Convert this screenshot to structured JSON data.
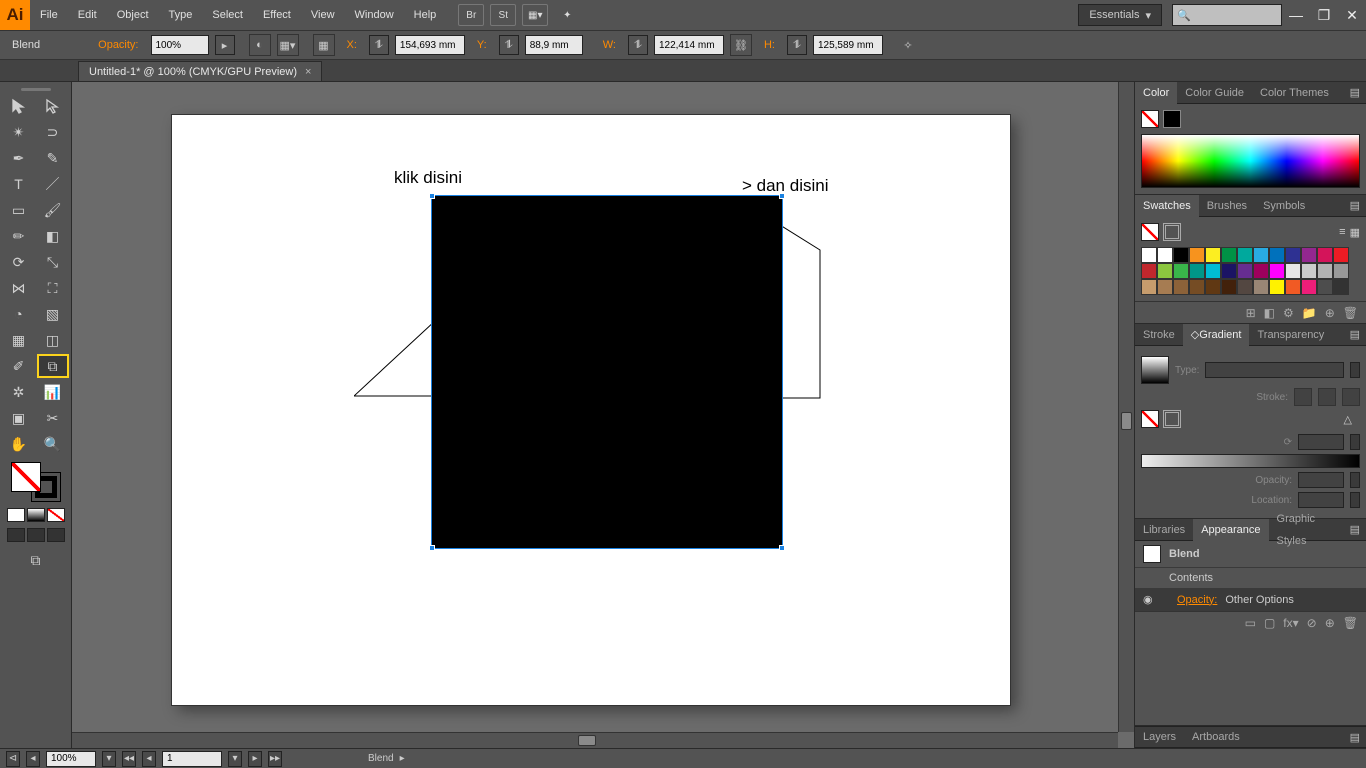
{
  "menu": [
    "File",
    "Edit",
    "Object",
    "Type",
    "Select",
    "Effect",
    "View",
    "Window",
    "Help"
  ],
  "workspace": "Essentials",
  "control": {
    "tool": "Blend",
    "opacity_label": "Opacity:",
    "opacity": "100%",
    "x_label": "X:",
    "x": "154,693 mm",
    "y_label": "Y:",
    "y": "88,9 mm",
    "w_label": "W:",
    "w": "122,414 mm",
    "h_label": "H:",
    "h": "125,589 mm"
  },
  "doc_tab": "Untitled-1* @ 100% (CMYK/GPU Preview)",
  "canvas": {
    "anno1": "klik disini",
    "anno2": "> dan disini"
  },
  "panels": {
    "color_tabs": [
      "Color",
      "Color Guide",
      "Color Themes"
    ],
    "swatch_tabs": [
      "Swatches",
      "Brushes",
      "Symbols"
    ],
    "grad_tabs": [
      "Stroke",
      "Gradient",
      "Transparency"
    ],
    "grad_type": "Type:",
    "grad_stroke": "Stroke:",
    "grad_opacity": "Opacity:",
    "grad_location": "Location:",
    "app_tabs": [
      "Libraries",
      "Appearance",
      "Graphic Styles"
    ],
    "app_rows": {
      "r1": "Blend",
      "r2": "Contents",
      "r3a": "Opacity:",
      "r3b": "Other Options"
    },
    "bottom_tabs": [
      "Layers",
      "Artboards"
    ]
  },
  "swatches_colors": [
    "#ffffff",
    "#ffffff",
    "#000000",
    "#f7931e",
    "#fcee21",
    "#009245",
    "#00a99d",
    "#29abe2",
    "#0071bc",
    "#2e3192",
    "#93278f",
    "#d4145a",
    "#ed1c24",
    "#c1272d",
    "#8cc63f",
    "#39b54a",
    "#009688",
    "#00bcd4",
    "#1b1464",
    "#662d91",
    "#9e005d",
    "#ff00ff",
    "#e6e6e6",
    "#cccccc",
    "#b3b3b3",
    "#999999",
    "#c69c6d",
    "#a67c52",
    "#8c6239",
    "#754c24",
    "#603813",
    "#42210b",
    "#534741",
    "#998675",
    "#fff200",
    "#f15a24",
    "#ed1e79",
    "#4d4d4d",
    "#333333"
  ],
  "status": {
    "zoom": "100%",
    "artboard": "1",
    "tool": "Blend"
  }
}
